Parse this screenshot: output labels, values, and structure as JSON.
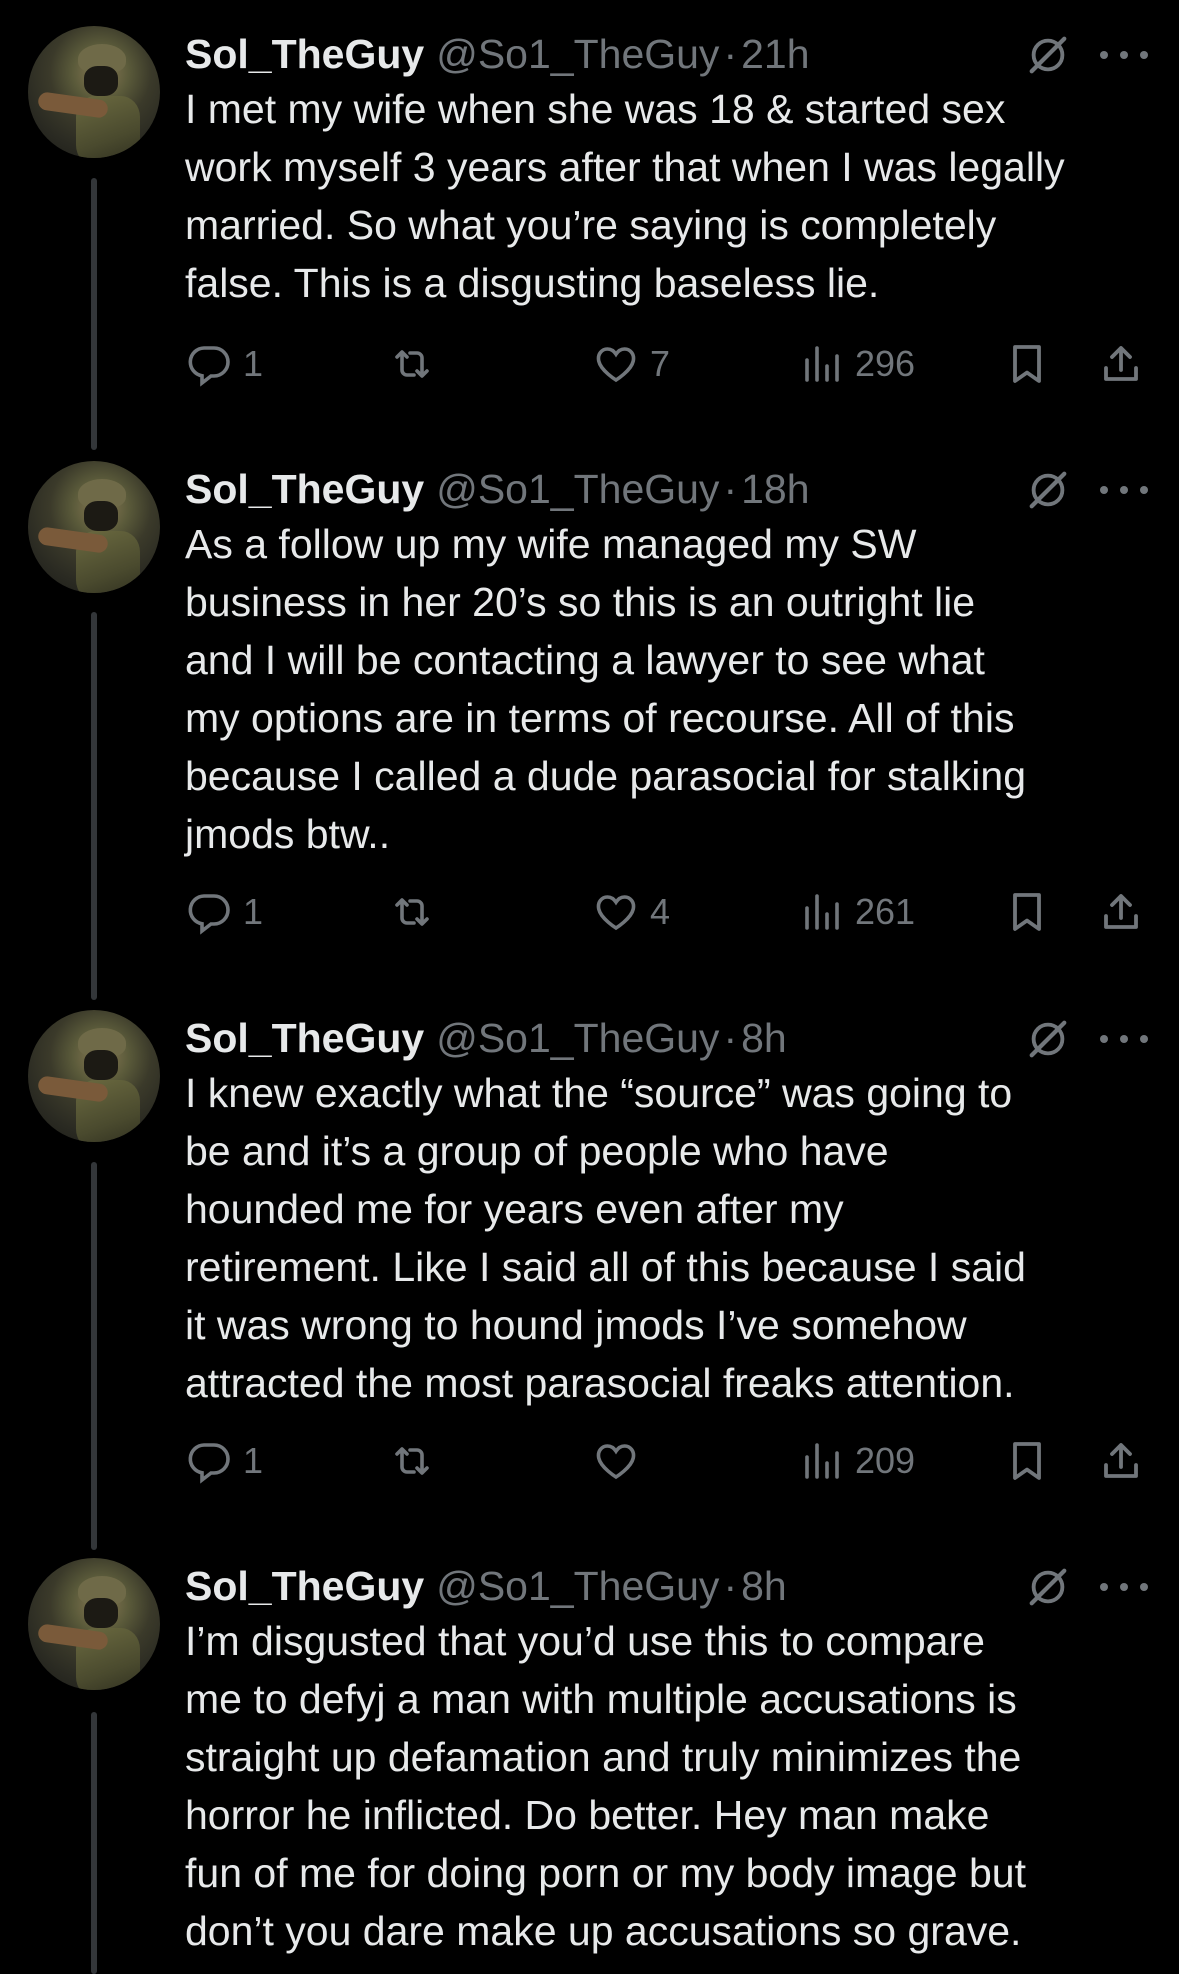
{
  "tweets": [
    {
      "author_name": "Sol_TheGuy",
      "handle": "@So1_TheGuy",
      "separator": "·",
      "time": "21h",
      "text": "I met my wife when she was 18 & started sex\nwork myself 3 years after that when I was legally\nmarried. So what you’re saying is completely\nfalse. This is a disgusting baseless lie.",
      "replies": "1",
      "retweets": "",
      "likes": "7",
      "views": "296"
    },
    {
      "author_name": "Sol_TheGuy",
      "handle": "@So1_TheGuy",
      "separator": "·",
      "time": "18h",
      "text": "As a follow up my wife managed my SW\nbusiness in her 20’s so this is an outright lie\nand I will be contacting a lawyer to see what\nmy options are in terms of recourse. All of this\nbecause I called a dude parasocial for stalking\njmods btw..",
      "replies": "1",
      "retweets": "",
      "likes": "4",
      "views": "261"
    },
    {
      "author_name": "Sol_TheGuy",
      "handle": "@So1_TheGuy",
      "separator": "·",
      "time": "8h",
      "text": "I knew exactly what the “source” was going to\nbe and it’s a group of people who have\nhounded me for years even after my\nretirement. Like I said all of this because I said\nit was wrong to hound jmods I’ve somehow\nattracted the most parasocial freaks attention.",
      "replies": "1",
      "retweets": "",
      "likes": "",
      "views": "209"
    },
    {
      "author_name": "Sol_TheGuy",
      "handle": "@So1_TheGuy",
      "separator": "·",
      "time": "8h",
      "text": "I’m disgusted that you’d use this to compare\nme to defyj a man with multiple accusations is\nstraight up defamation and truly minimizes the\nhorror he inflicted. Do better. Hey man make\nfun of me for doing porn or my body image but\ndon’t you dare make up accusations so grave.",
      "replies": "",
      "retweets": "",
      "likes": "",
      "views": ""
    }
  ],
  "icons": {
    "reply": "reply-icon",
    "retweet": "retweet-icon",
    "like": "heart-icon",
    "views": "views-icon",
    "bookmark": "bookmark-icon",
    "share": "share-icon",
    "grok": "grok-icon",
    "more": "more-icon"
  },
  "colors": {
    "background": "#000000",
    "text": "#e7e9ea",
    "secondary": "#71767b",
    "thread_line": "#333639"
  }
}
